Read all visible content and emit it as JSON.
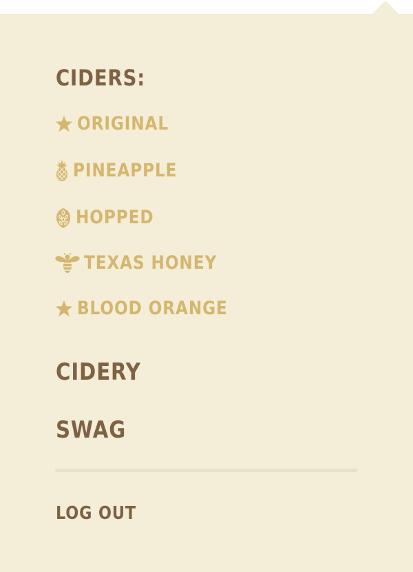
{
  "menu": {
    "heading": "CIDERS:",
    "ciders": [
      {
        "label": "ORIGINAL",
        "icon": "star-icon"
      },
      {
        "label": "PINEAPPLE",
        "icon": "pineapple-icon"
      },
      {
        "label": "HOPPED",
        "icon": "hop-icon"
      },
      {
        "label": "TEXAS HONEY",
        "icon": "bee-icon"
      },
      {
        "label": "BLOOD ORANGE",
        "icon": "star-icon"
      }
    ],
    "links": [
      {
        "label": "CIDERY"
      },
      {
        "label": "SWAG"
      }
    ],
    "logout_label": "LOG OUT"
  },
  "colors": {
    "panel_background": "#f4edd7",
    "heading_brown": "#7e6243",
    "item_gold": "#d4b76e",
    "divider": "#e7e0cb"
  }
}
